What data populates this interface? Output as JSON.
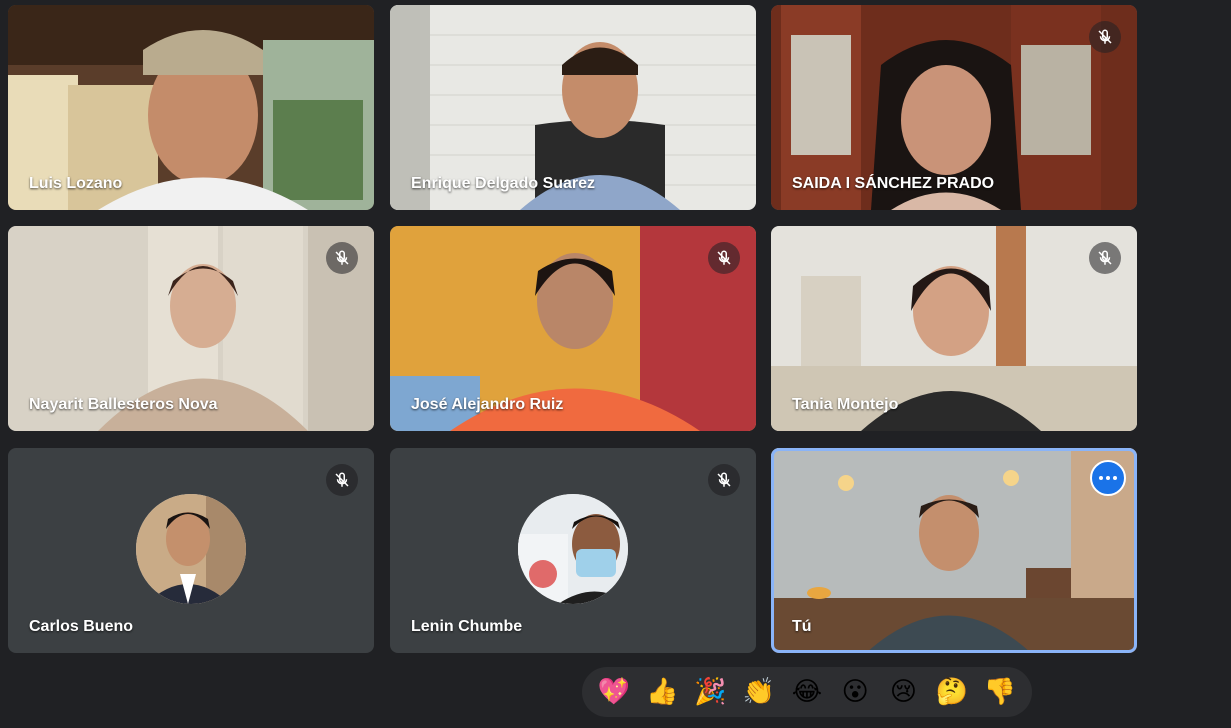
{
  "participants": [
    {
      "name": "Luis Lozano",
      "muted": false
    },
    {
      "name": "Enrique Delgado Suarez",
      "muted": false
    },
    {
      "name": "SAIDA I SÁNCHEZ PRADO",
      "muted": true
    },
    {
      "name": "Nayarit Ballesteros Nova",
      "muted": true
    },
    {
      "name": "José Alejandro Ruiz",
      "muted": true
    },
    {
      "name": "Tania Montejo",
      "muted": true
    },
    {
      "name": "Carlos Bueno",
      "muted": true,
      "camera": "off"
    },
    {
      "name": "Lenin Chumbe",
      "muted": true,
      "camera": "off"
    },
    {
      "name": "Tú",
      "muted": false,
      "self": true
    }
  ],
  "icons": {
    "mic_off": "mic-off-icon",
    "more_options": "more-options-icon"
  },
  "reactions": [
    "💖",
    "👍",
    "🎉",
    "👏",
    "😂",
    "😮",
    "😢",
    "🤔",
    "👎"
  ],
  "colors": {
    "background": "#202124",
    "tile_off": "#3c4043",
    "self_highlight": "#8ab4f8",
    "more_button": "#1a73e8"
  }
}
